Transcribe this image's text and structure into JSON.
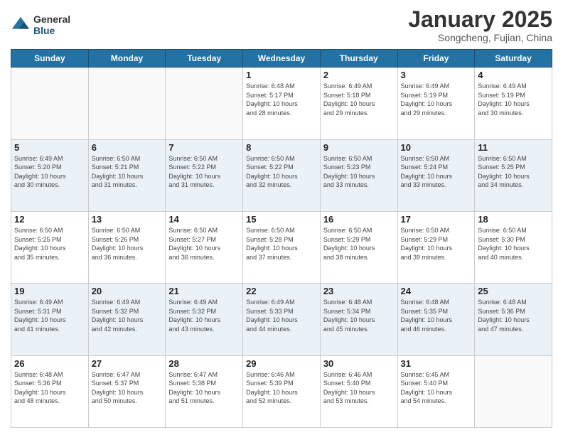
{
  "logo": {
    "general": "General",
    "blue": "Blue"
  },
  "header": {
    "month": "January 2025",
    "location": "Songcheng, Fujian, China"
  },
  "weekdays": [
    "Sunday",
    "Monday",
    "Tuesday",
    "Wednesday",
    "Thursday",
    "Friday",
    "Saturday"
  ],
  "weeks": [
    [
      {
        "day": "",
        "info": ""
      },
      {
        "day": "",
        "info": ""
      },
      {
        "day": "",
        "info": ""
      },
      {
        "day": "1",
        "info": "Sunrise: 6:48 AM\nSunset: 5:17 PM\nDaylight: 10 hours\nand 28 minutes."
      },
      {
        "day": "2",
        "info": "Sunrise: 6:49 AM\nSunset: 5:18 PM\nDaylight: 10 hours\nand 29 minutes."
      },
      {
        "day": "3",
        "info": "Sunrise: 6:49 AM\nSunset: 5:19 PM\nDaylight: 10 hours\nand 29 minutes."
      },
      {
        "day": "4",
        "info": "Sunrise: 6:49 AM\nSunset: 5:19 PM\nDaylight: 10 hours\nand 30 minutes."
      }
    ],
    [
      {
        "day": "5",
        "info": "Sunrise: 6:49 AM\nSunset: 5:20 PM\nDaylight: 10 hours\nand 30 minutes."
      },
      {
        "day": "6",
        "info": "Sunrise: 6:50 AM\nSunset: 5:21 PM\nDaylight: 10 hours\nand 31 minutes."
      },
      {
        "day": "7",
        "info": "Sunrise: 6:50 AM\nSunset: 5:22 PM\nDaylight: 10 hours\nand 31 minutes."
      },
      {
        "day": "8",
        "info": "Sunrise: 6:50 AM\nSunset: 5:22 PM\nDaylight: 10 hours\nand 32 minutes."
      },
      {
        "day": "9",
        "info": "Sunrise: 6:50 AM\nSunset: 5:23 PM\nDaylight: 10 hours\nand 33 minutes."
      },
      {
        "day": "10",
        "info": "Sunrise: 6:50 AM\nSunset: 5:24 PM\nDaylight: 10 hours\nand 33 minutes."
      },
      {
        "day": "11",
        "info": "Sunrise: 6:50 AM\nSunset: 5:25 PM\nDaylight: 10 hours\nand 34 minutes."
      }
    ],
    [
      {
        "day": "12",
        "info": "Sunrise: 6:50 AM\nSunset: 5:25 PM\nDaylight: 10 hours\nand 35 minutes."
      },
      {
        "day": "13",
        "info": "Sunrise: 6:50 AM\nSunset: 5:26 PM\nDaylight: 10 hours\nand 36 minutes."
      },
      {
        "day": "14",
        "info": "Sunrise: 6:50 AM\nSunset: 5:27 PM\nDaylight: 10 hours\nand 36 minutes."
      },
      {
        "day": "15",
        "info": "Sunrise: 6:50 AM\nSunset: 5:28 PM\nDaylight: 10 hours\nand 37 minutes."
      },
      {
        "day": "16",
        "info": "Sunrise: 6:50 AM\nSunset: 5:29 PM\nDaylight: 10 hours\nand 38 minutes."
      },
      {
        "day": "17",
        "info": "Sunrise: 6:50 AM\nSunset: 5:29 PM\nDaylight: 10 hours\nand 39 minutes."
      },
      {
        "day": "18",
        "info": "Sunrise: 6:50 AM\nSunset: 5:30 PM\nDaylight: 10 hours\nand 40 minutes."
      }
    ],
    [
      {
        "day": "19",
        "info": "Sunrise: 6:49 AM\nSunset: 5:31 PM\nDaylight: 10 hours\nand 41 minutes."
      },
      {
        "day": "20",
        "info": "Sunrise: 6:49 AM\nSunset: 5:32 PM\nDaylight: 10 hours\nand 42 minutes."
      },
      {
        "day": "21",
        "info": "Sunrise: 6:49 AM\nSunset: 5:32 PM\nDaylight: 10 hours\nand 43 minutes."
      },
      {
        "day": "22",
        "info": "Sunrise: 6:49 AM\nSunset: 5:33 PM\nDaylight: 10 hours\nand 44 minutes."
      },
      {
        "day": "23",
        "info": "Sunrise: 6:48 AM\nSunset: 5:34 PM\nDaylight: 10 hours\nand 45 minutes."
      },
      {
        "day": "24",
        "info": "Sunrise: 6:48 AM\nSunset: 5:35 PM\nDaylight: 10 hours\nand 46 minutes."
      },
      {
        "day": "25",
        "info": "Sunrise: 6:48 AM\nSunset: 5:36 PM\nDaylight: 10 hours\nand 47 minutes."
      }
    ],
    [
      {
        "day": "26",
        "info": "Sunrise: 6:48 AM\nSunset: 5:36 PM\nDaylight: 10 hours\nand 48 minutes."
      },
      {
        "day": "27",
        "info": "Sunrise: 6:47 AM\nSunset: 5:37 PM\nDaylight: 10 hours\nand 50 minutes."
      },
      {
        "day": "28",
        "info": "Sunrise: 6:47 AM\nSunset: 5:38 PM\nDaylight: 10 hours\nand 51 minutes."
      },
      {
        "day": "29",
        "info": "Sunrise: 6:46 AM\nSunset: 5:39 PM\nDaylight: 10 hours\nand 52 minutes."
      },
      {
        "day": "30",
        "info": "Sunrise: 6:46 AM\nSunset: 5:40 PM\nDaylight: 10 hours\nand 53 minutes."
      },
      {
        "day": "31",
        "info": "Sunrise: 6:45 AM\nSunset: 5:40 PM\nDaylight: 10 hours\nand 54 minutes."
      },
      {
        "day": "",
        "info": ""
      }
    ]
  ]
}
